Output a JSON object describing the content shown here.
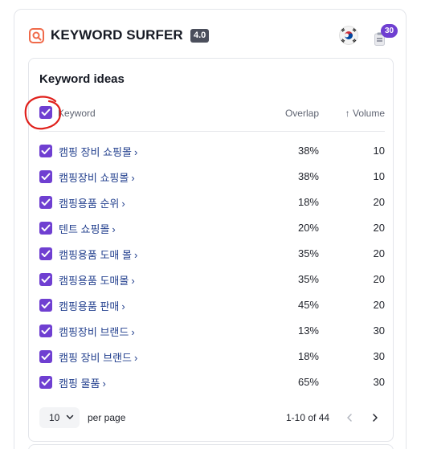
{
  "header": {
    "brand": "KEYWORD SURFER",
    "version": "4.0",
    "credits": "30",
    "country_icon": "south-korea-flag-icon"
  },
  "panel": {
    "title": "Keyword ideas",
    "columns": {
      "keyword": "Keyword",
      "overlap": "Overlap",
      "volume": "↑ Volume"
    },
    "rows": [
      {
        "keyword": "캠핑 장비 쇼핑몰",
        "overlap": "38%",
        "volume": "10"
      },
      {
        "keyword": "캠핑장비 쇼핑몰",
        "overlap": "38%",
        "volume": "10"
      },
      {
        "keyword": "캠핑용품 순위",
        "overlap": "18%",
        "volume": "20"
      },
      {
        "keyword": "텐트 쇼핑몰",
        "overlap": "20%",
        "volume": "20"
      },
      {
        "keyword": "캠핑용품 도매 몰",
        "overlap": "35%",
        "volume": "20"
      },
      {
        "keyword": "캠핑용품 도매몰",
        "overlap": "35%",
        "volume": "20"
      },
      {
        "keyword": "캠핑용품 판매",
        "overlap": "45%",
        "volume": "20"
      },
      {
        "keyword": "캠핑장비 브랜드",
        "overlap": "13%",
        "volume": "30"
      },
      {
        "keyword": "캠핑 장비 브랜드",
        "overlap": "18%",
        "volume": "30"
      },
      {
        "keyword": "캠핑 물품",
        "overlap": "65%",
        "volume": "30"
      }
    ],
    "pagination": {
      "page_size": "10",
      "per_page_label": "per page",
      "range": "1-10 of 44"
    }
  },
  "colors": {
    "accent": "#6f3fd1",
    "link": "#23408e",
    "annotation": "#e0201b"
  }
}
